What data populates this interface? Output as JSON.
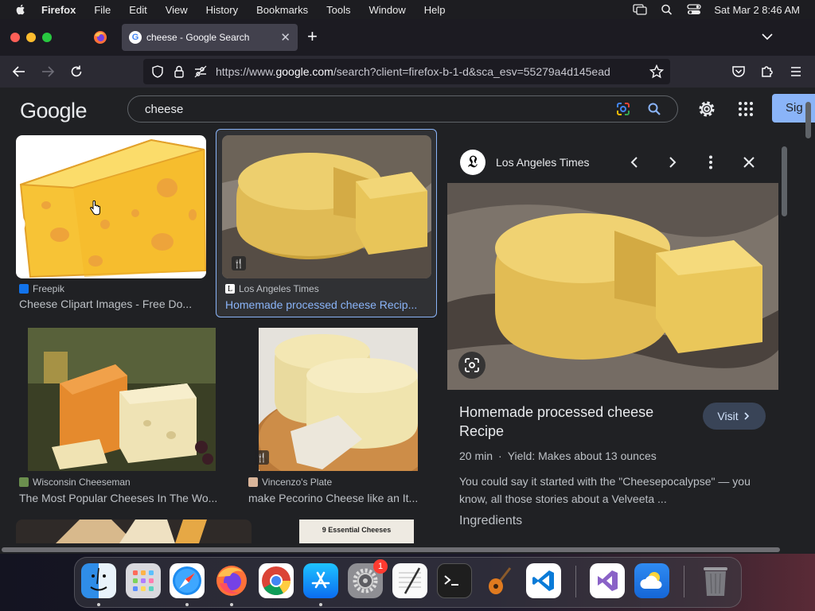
{
  "menubar": {
    "app_name": "Firefox",
    "items": [
      "File",
      "Edit",
      "View",
      "History",
      "Bookmarks",
      "Tools",
      "Window",
      "Help"
    ],
    "clock": "Sat Mar 2  8:46 AM"
  },
  "browser": {
    "tab_title": "cheese - Google Search",
    "url_host": "https://www.google.com",
    "url_rest": "/search?client=firefox-b-1-d&sca_esv=55279a4d145ead",
    "url_domain": "google.com"
  },
  "google": {
    "logo": "Google",
    "query": "cheese",
    "signin_label": "Sig"
  },
  "results": [
    {
      "source": "Freepik",
      "title": "Cheese Clipart Images - Free Do..."
    },
    {
      "source": "Los Angeles Times",
      "title": "Homemade processed cheese Recip..."
    },
    {
      "source": "Wisconsin Cheeseman",
      "title": "The Most Popular Cheeses In The Wo..."
    },
    {
      "source": "Vincenzo's Plate",
      "title": "make Pecorino Cheese like an It..."
    },
    {
      "source": "",
      "title": "",
      "caption": "9 Essential Cheeses"
    }
  ],
  "panel": {
    "source": "Los Angeles Times",
    "title": "Homemade processed cheese Recipe",
    "visit_label": "Visit",
    "time": "20 min",
    "yield": "Yield: Makes about 13 ounces",
    "description": "You could say it started with the \"Cheesepocalypse\" — you know, all those stories about a Velveeta ...",
    "section": "Ingredients"
  },
  "dock": {
    "apps": [
      "Finder",
      "Launchpad",
      "Safari",
      "Firefox",
      "Chrome",
      "App Store",
      "System Settings",
      "TextEdit",
      "Terminal",
      "GarageBand",
      "VS Code",
      "Visual Studio",
      "Weather",
      "Trash"
    ],
    "settings_badge": "1"
  },
  "colors": {
    "accent": "#8ab4f8",
    "page_bg": "#202124",
    "tab_bg": "#42414d"
  }
}
